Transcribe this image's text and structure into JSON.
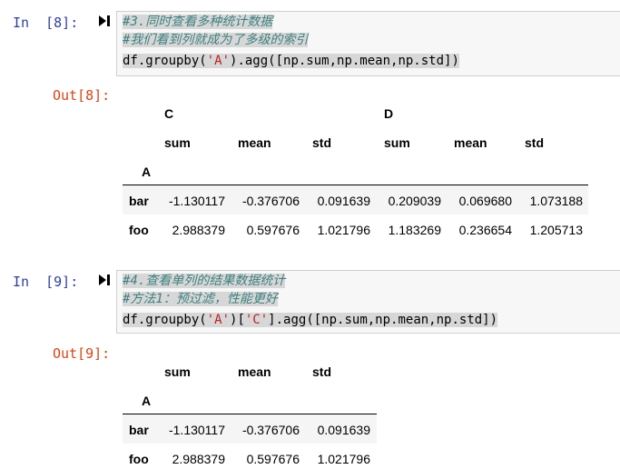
{
  "cell8": {
    "in_prompt": "In  [8]:",
    "out_prompt": "Out[8]:",
    "code": {
      "line1": "#3.同时查看多种统计数据",
      "line2": "#我们看到列就成为了多级的索引",
      "line3_prefix": "df.groupby(",
      "line3_str": "'A'",
      "line3_suffix": ").agg([np.sum,np.mean,np.std])"
    },
    "table": {
      "level0": [
        "C",
        "D"
      ],
      "level1": [
        "sum",
        "mean",
        "std",
        "sum",
        "mean",
        "std"
      ],
      "index_name": "A",
      "rows": [
        {
          "idx": "bar",
          "vals": [
            "-1.130117",
            "-0.376706",
            "0.091639",
            "0.209039",
            "0.069680",
            "1.073188"
          ]
        },
        {
          "idx": "foo",
          "vals": [
            "2.988379",
            "0.597676",
            "1.021796",
            "1.183269",
            "0.236654",
            "1.205713"
          ]
        }
      ]
    }
  },
  "cell9": {
    "in_prompt": "In  [9]:",
    "out_prompt": "Out[9]:",
    "code": {
      "line1": "#4.查看单列的结果数据统计",
      "line2": "#方法1：预过滤，性能更好",
      "line3_prefix": "df.groupby(",
      "line3_str1": "'A'",
      "line3_mid": ")[",
      "line3_str2": "'C'",
      "line3_suffix": "].agg([np.sum,np.mean,np.std])"
    },
    "table": {
      "level1": [
        "sum",
        "mean",
        "std"
      ],
      "index_name": "A",
      "rows": [
        {
          "idx": "bar",
          "vals": [
            "-1.130117",
            "-0.376706",
            "0.091639"
          ]
        },
        {
          "idx": "foo",
          "vals": [
            "2.988379",
            "0.597676",
            "1.021796"
          ]
        }
      ]
    }
  }
}
